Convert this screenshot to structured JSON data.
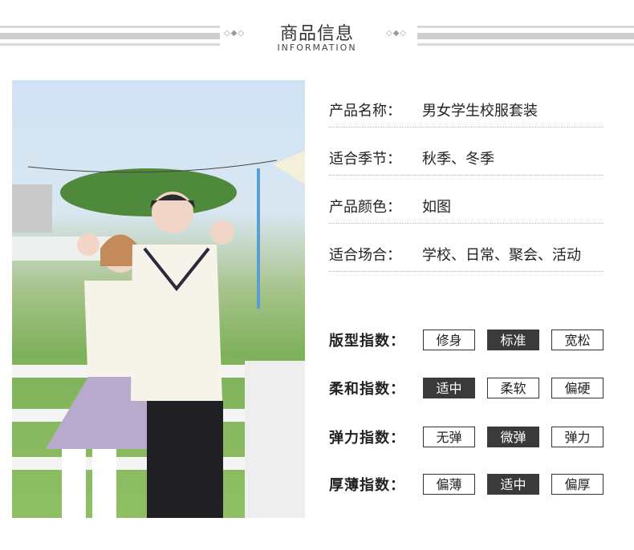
{
  "header": {
    "title": "商品信息",
    "subtitle": "INFORMATION"
  },
  "info": [
    {
      "label": "产品名称：",
      "value": "男女学生校服套装"
    },
    {
      "label": "适合季节：",
      "value": "秋季、冬季"
    },
    {
      "label": "产品颜色：",
      "value": "如图"
    },
    {
      "label": "适合场合：",
      "value": "学校、日常、聚会、活动"
    }
  ],
  "indices": [
    {
      "label": "版型指数：",
      "options": [
        "修身",
        "标准",
        "宽松"
      ],
      "selected_index": 1
    },
    {
      "label": "柔和指数：",
      "options": [
        "适中",
        "柔软",
        "偏硬"
      ],
      "selected_index": 0
    },
    {
      "label": "弹力指数：",
      "options": [
        "无弹",
        "微弹",
        "弹力"
      ],
      "selected_index": 1
    },
    {
      "label": "厚薄指数：",
      "options": [
        "偏薄",
        "适中",
        "偏厚"
      ],
      "selected_index": 1
    }
  ],
  "colors": {
    "selected_bg": "#3a3a3a",
    "border": "#333333",
    "divider": "#d9d9d9"
  }
}
